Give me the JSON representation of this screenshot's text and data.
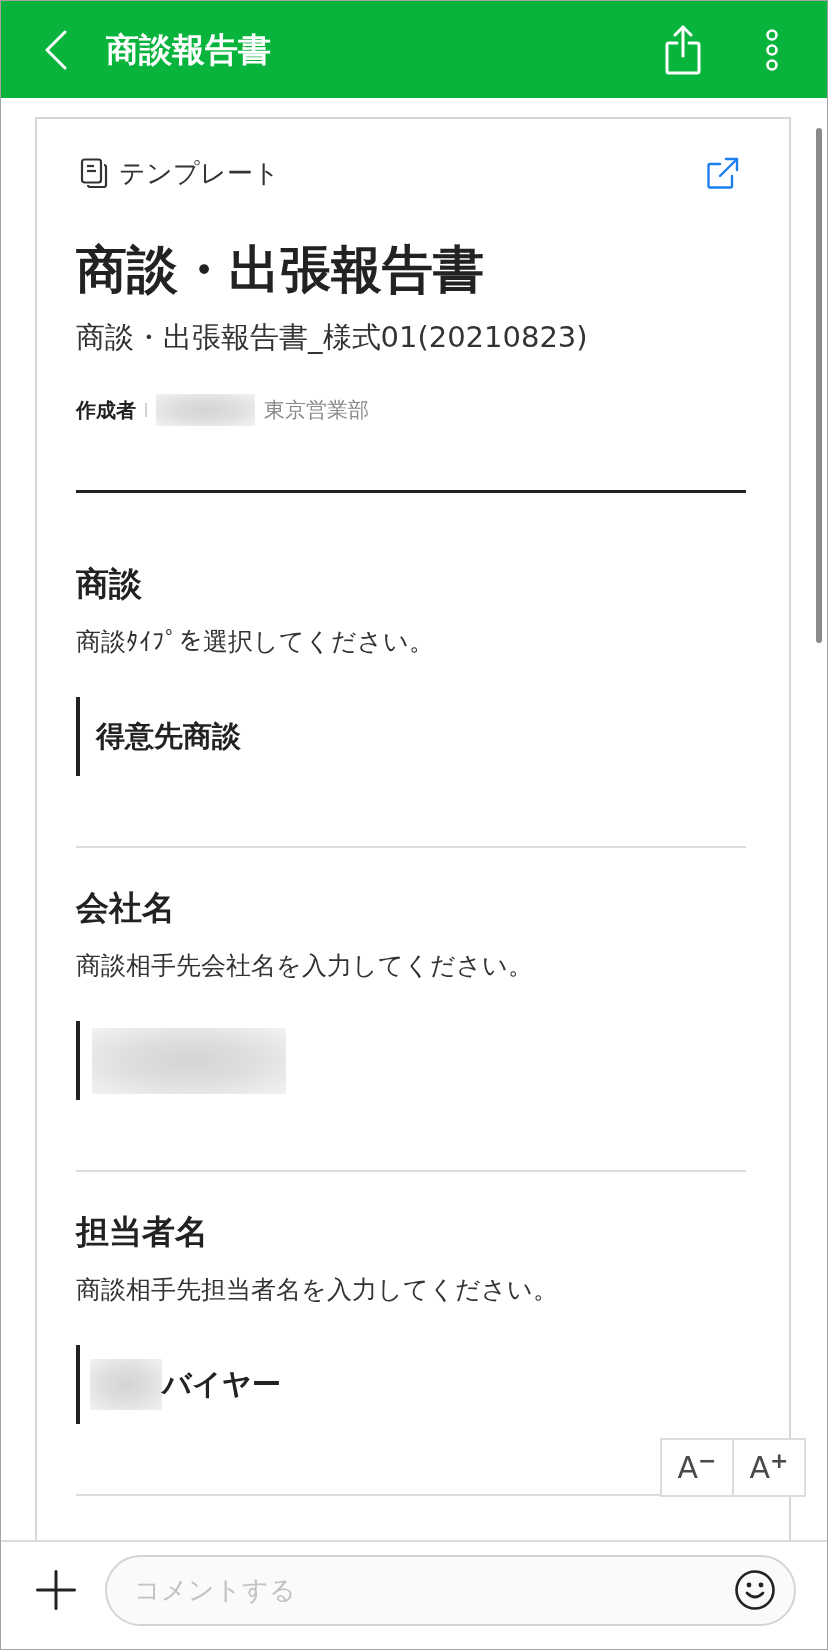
{
  "header": {
    "title": "商談報告書"
  },
  "template": {
    "label": "テンプレート",
    "title": "商談・出張報告書",
    "subtitle": "商談・出張報告書_様式01(20210823)",
    "author": {
      "label": "作成者",
      "parts": [
        {
          "kind": "redacted"
        },
        {
          "kind": "text",
          "text": "東京営業部"
        }
      ]
    }
  },
  "sections": [
    {
      "heading": "商談",
      "description": "商談ﾀｲﾌﾟを選択してください。",
      "answer": [
        {
          "kind": "text",
          "text": "得意先商談"
        }
      ]
    },
    {
      "heading": "会社名",
      "description": "商談相手先会社名を入力してください。",
      "answer": [
        {
          "kind": "redacted"
        }
      ]
    },
    {
      "heading": "担当者名",
      "description": "商談相手先担当者名を入力してください。",
      "answer": [
        {
          "kind": "redacted"
        },
        {
          "kind": "text",
          "text": "バイヤー"
        }
      ]
    }
  ],
  "font_buttons": [
    {
      "label": "A$^{−}$"
    },
    {
      "label": "A$^{+}$"
    }
  ],
  "comment": {
    "placeholder": "コメントする"
  }
}
